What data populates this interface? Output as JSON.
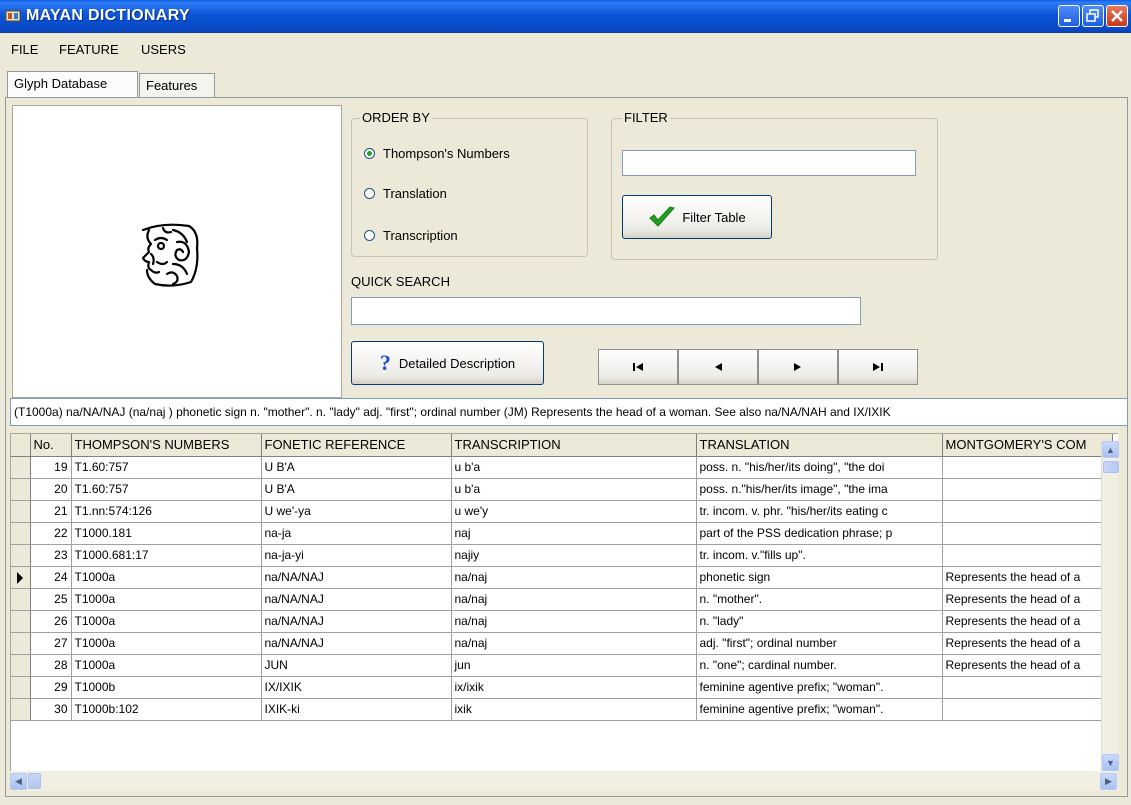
{
  "window": {
    "title": "MAYAN DICTIONARY"
  },
  "menu": {
    "items": [
      "FILE",
      "FEATURE",
      "USERS"
    ]
  },
  "tabs": [
    "Glyph Database",
    "Features"
  ],
  "order_by": {
    "label": "ORDER BY",
    "options": [
      "Thompson's Numbers",
      "Translation",
      "Transcription"
    ],
    "selected": "Thompson's Numbers"
  },
  "filter": {
    "label": "FILTER",
    "value": "",
    "button_label": "Filter Table"
  },
  "quick_search": {
    "label": "QUICK SEARCH",
    "value": ""
  },
  "detailed_button": {
    "label": "Detailed Description"
  },
  "description_text": "(T1000a) na/NA/NAJ (na/naj ) phonetic sign n. \"mother\". n. \"lady\" adj. \"first\"; ordinal number (JM) Represents the head of a woman. See also na/NA/NAH and IX/IXIK",
  "table": {
    "columns": [
      "No.",
      "THOMPSON'S NUMBERS",
      "FONETIC REFERENCE",
      "TRANSCRIPTION",
      "TRANSLATION",
      "MONTGOMERY'S COM"
    ],
    "selected_row": 5,
    "rows": [
      {
        "no": "19",
        "thompson": "T1.60:757",
        "fonetic": "U B'A",
        "transcription": "u b'a",
        "translation": "poss. n. \"his/her/its doing\", \"the doi",
        "montgomery": ""
      },
      {
        "no": "20",
        "thompson": "T1.60:757",
        "fonetic": "U B'A",
        "transcription": "u b'a",
        "translation": "poss. n.\"his/her/its image\", \"the ima",
        "montgomery": ""
      },
      {
        "no": "21",
        "thompson": "T1.nn:574:126",
        "fonetic": "U we'-ya",
        "transcription": "u we'y",
        "translation": "tr. incom. v. phr. \"his/her/its eating c",
        "montgomery": ""
      },
      {
        "no": "22",
        "thompson": "T1000.181",
        "fonetic": "na-ja",
        "transcription": "naj",
        "translation": "part of the PSS dedication phrase; p",
        "montgomery": ""
      },
      {
        "no": "23",
        "thompson": "T1000.681:17",
        "fonetic": "na-ja-yi",
        "transcription": "najiy",
        "translation": "tr. incom. v.\"fills up\".",
        "montgomery": ""
      },
      {
        "no": "24",
        "thompson": "T1000a",
        "fonetic": "na/NA/NAJ",
        "transcription": "na/naj",
        "translation": "phonetic sign",
        "montgomery": "Represents the head of a"
      },
      {
        "no": "25",
        "thompson": "T1000a",
        "fonetic": "na/NA/NAJ",
        "transcription": "na/naj",
        "translation": "n. \"mother\".",
        "montgomery": "Represents the head of a"
      },
      {
        "no": "26",
        "thompson": "T1000a",
        "fonetic": "na/NA/NAJ",
        "transcription": "na/naj",
        "translation": "n. \"lady\"",
        "montgomery": "Represents the head of a"
      },
      {
        "no": "27",
        "thompson": "T1000a",
        "fonetic": "na/NA/NAJ",
        "transcription": "na/naj",
        "translation": "adj. \"first\"; ordinal number",
        "montgomery": "Represents the head of a"
      },
      {
        "no": "28",
        "thompson": "T1000a",
        "fonetic": "JUN",
        "transcription": "jun",
        "translation": "n. \"one\"; cardinal number.",
        "montgomery": "Represents the head of a"
      },
      {
        "no": "29",
        "thompson": "T1000b",
        "fonetic": "IX/IXIK",
        "transcription": "ix/ixik",
        "translation": "feminine agentive prefix; \"woman\".",
        "montgomery": ""
      },
      {
        "no": "30",
        "thompson": "T1000b:102",
        "fonetic": "IXIK-ki",
        "transcription": "ixik",
        "translation": "feminine agentive prefix; \"woman\".",
        "montgomery": ""
      }
    ]
  },
  "colors": {
    "titlebar": "#0A5FE4",
    "face": "#ECE9D8",
    "check": "#21A121",
    "help": "#1F4FC9"
  },
  "icons": [
    "app-icon",
    "minimize-icon",
    "maximize-icon",
    "close-icon",
    "glyph-image",
    "checkmark-icon",
    "question-icon",
    "first-record-icon",
    "previous-record-icon",
    "next-record-icon",
    "last-record-icon",
    "current-row-arrow-icon",
    "scroll-up-icon",
    "scroll-down-icon",
    "scroll-left-icon",
    "scroll-right-icon"
  ]
}
